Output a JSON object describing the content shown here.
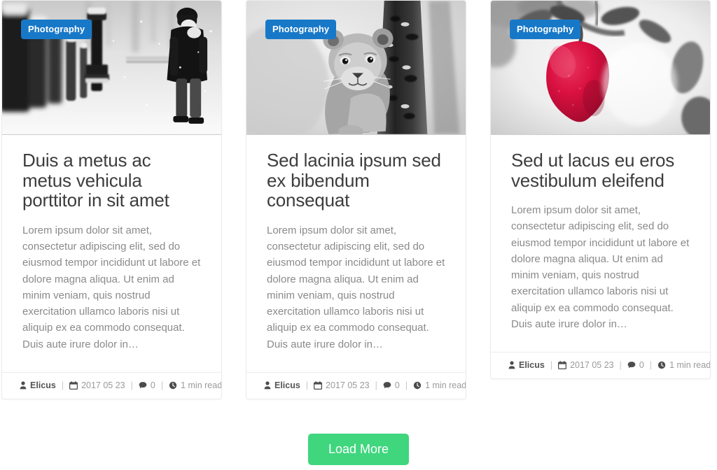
{
  "cards": [
    {
      "badge": "Photography",
      "title": "Duis a metus ac metus vehicula porttitor in sit amet",
      "excerpt": "Lorem ipsum dolor sit amet, consectetur adipiscing elit, sed do eiusmod tempor incididunt ut labore et dolore magna aliqua. Ut enim ad minim veniam, quis nostrud exercitation ullamco laboris nisi ut aliquip ex ea commodo consequat. Duis aute irure dolor in…",
      "author": "Elicus",
      "date": "2017 05 23",
      "comments": "0",
      "read_time": "1 min read",
      "image_alt": "snowy-street-pedestrian-photo"
    },
    {
      "badge": "Photography",
      "title": "Sed lacinia ipsum sed ex bibendum consequat",
      "excerpt": "Lorem ipsum dolor sit amet, consectetur adipiscing elit, sed do eiusmod tempor incididunt ut labore et dolore magna aliqua. Ut enim ad minim veniam, quis nostrud exercitation ullamco laboris nisi ut aliquip ex ea commodo consequat. Duis aute irure dolor in…",
      "author": "Elicus",
      "date": "2017 05 23",
      "comments": "0",
      "read_time": "1 min read",
      "image_alt": "lion-cub-behind-tree-photo"
    },
    {
      "badge": "Photography",
      "title": "Sed ut lacus eu eros vestibulum eleifend",
      "excerpt": "Lorem ipsum dolor sit amet, consectetur adipiscing elit, sed do eiusmod tempor incididunt ut labore et dolore magna aliqua. Ut enim ad minim veniam, quis nostrud exercitation ullamco laboris nisi ut aliquip ex ea commodo consequat. Duis aute irure dolor in…",
      "author": "Elicus",
      "date": "2017 05 23",
      "comments": "0",
      "read_time": "1 min read",
      "image_alt": "red-apple-on-branch-photo"
    }
  ],
  "separator": "|",
  "load_more": {
    "label": "Load More"
  },
  "colors": {
    "badge_blue": "#1878c8",
    "load_more_green": "#3fd67e",
    "title_gray": "#3d3d3d",
    "body_gray": "#8a8a8a",
    "meta_gray": "#9a9a9a",
    "card_border": "#ececec",
    "apple_red": "#d91040"
  },
  "icons": {
    "author": "user-icon",
    "date": "calendar-icon",
    "comments": "comment-icon",
    "read_time": "clock-icon"
  }
}
